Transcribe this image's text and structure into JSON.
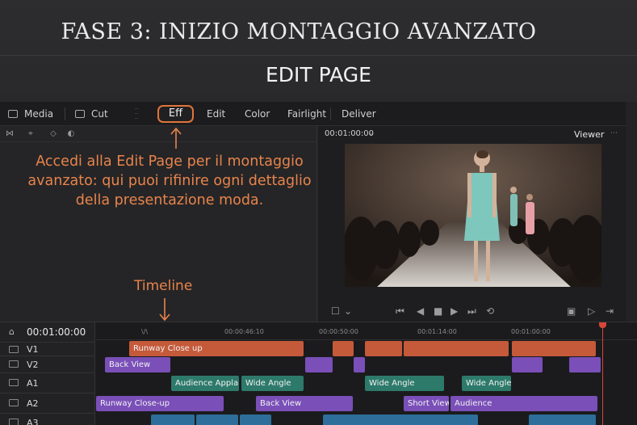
{
  "hero": {
    "title": "FASE 3: INIZIO MONTAGGIO AVANZATO",
    "subtitle": "EDIT PAGE"
  },
  "pages": {
    "media": "Media",
    "cut": "Cut",
    "active": "Eff",
    "edit": "Edit",
    "color": "Color",
    "fairlight": "Fairlight",
    "deliver": "Deliver"
  },
  "callout": {
    "text": "Accedi alla Edit Page per il montaggio avanzato: qui puoi rifinire ogni dettaglio della presentazione moda.",
    "timeline_label": "Timeline",
    "color": "#e8844b"
  },
  "viewer": {
    "timecode": "00:01:00:00",
    "label": "Viewer"
  },
  "timeline": {
    "timecode": "00:01:00:00",
    "ruler": [
      "00:00:46:10",
      "00:00:50:00",
      "00:01:14:00",
      "00:01:00:00"
    ],
    "tracks": [
      "V1",
      "V2",
      "A1",
      "A2",
      "A3"
    ],
    "clips": {
      "v1": "Runway Close up",
      "v2": "Back View",
      "a1_1": "Audience Applause",
      "a1_2": "Wide Angle",
      "a1_3": "Wide Angle",
      "a1_4": "Wide Angle",
      "a2_1": "Runway Close-up",
      "a2_2": "Back View",
      "a2_3": "Short View",
      "a2_4": "Audience"
    }
  },
  "icons": [
    "media-icon",
    "cut-icon",
    "edit-tools-icon",
    "play-icon",
    "stop-icon",
    "skip-icon",
    "loop-icon"
  ]
}
